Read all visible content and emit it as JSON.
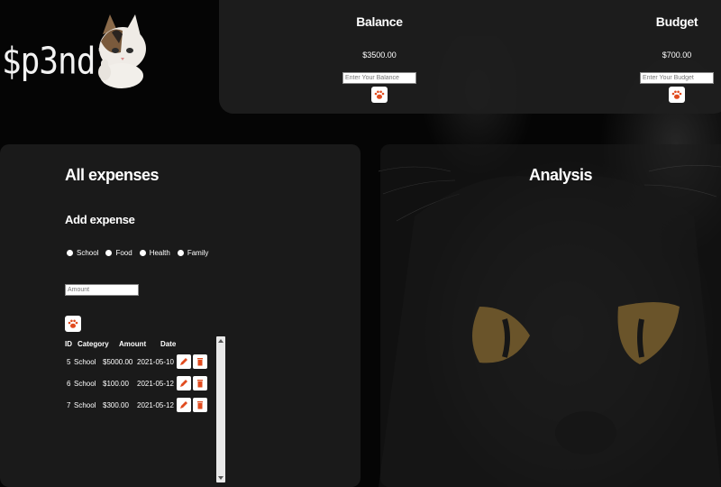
{
  "logo": {
    "text": "$p3nd1",
    "mascot_icon": "cat-thumbs-up-icon"
  },
  "header": {
    "balance": {
      "title": "Balance",
      "value": "$3500.00",
      "placeholder": "Enter Your Balance",
      "submit_icon": "paw-icon"
    },
    "budget": {
      "title": "Budget",
      "value": "$700.00",
      "placeholder": "Enter Your Budget",
      "submit_icon": "paw-icon"
    }
  },
  "expenses": {
    "title": "All expenses",
    "add_title": "Add expense",
    "categories": [
      "School",
      "Food",
      "Health",
      "Family"
    ],
    "amount_placeholder": "Amount",
    "add_icon": "paw-icon",
    "columns": [
      "ID",
      "Category",
      "Amount",
      "Date"
    ],
    "rows": [
      {
        "id": "5",
        "category": "School",
        "amount": "$5000.00",
        "date": "2021-05-10"
      },
      {
        "id": "6",
        "category": "School",
        "amount": "$100.00",
        "date": "2021-05-12"
      },
      {
        "id": "7",
        "category": "School",
        "amount": "$300.00",
        "date": "2021-05-12"
      }
    ]
  },
  "analysis": {
    "title": "Analysis"
  },
  "colors": {
    "accent": "#e14b1e",
    "panel": "#1b1b1b",
    "background": "#050505",
    "cat_eye": "#c99a3c"
  }
}
